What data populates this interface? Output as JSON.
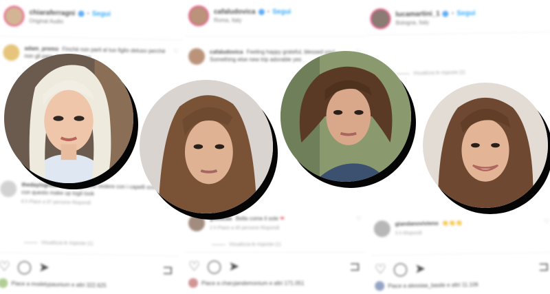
{
  "panels": [
    {
      "username": "chiaraferragni",
      "follow_label": "Segui",
      "subtitle": "Original Audio",
      "comments": [
        {
          "user": "adam_premo",
          "text": "Finchè non parli al tuo figlio deluso perché non gli pare che sia la cosa",
          "meta": "",
          "heart": "♡"
        },
        {
          "user": "thedayisgreat",
          "text": "Ma ti vogliamo vedere con i capelli sciolti e con questo make up logit look",
          "meta": "8 h   Piace a 97 persone   Rispondi",
          "heart": "♡"
        }
      ],
      "replies": "Visualizza le risposte (1)",
      "actions": {
        "like": "♡",
        "comment": "◯",
        "share": "➤",
        "save": "⊐"
      },
      "likes_text": "Piace a modelypaunium e altri 322.625"
    },
    {
      "username": "cafaludovica",
      "follow_label": "Segui",
      "subtitle": "Roma, Italy",
      "comments": [
        {
          "user": "cafaludovica",
          "text": "Feeling happy grateful, blessed you! Something else new trip adorable yes",
          "meta": "",
          "heart": "♡"
        },
        {
          "user": "giulucas",
          "text": "Bella come il sole",
          "emoji": "❤",
          "meta": "2 h   Piace a 40 persone   Rispondi",
          "heart": "♡"
        }
      ],
      "replies": "Visualizza le risposte (1)",
      "actions": {
        "like": "♡",
        "comment": "◯",
        "share": "➤",
        "save": "⊐"
      },
      "likes_text": "Piace a charyjandemonium e altri 171.051"
    },
    {
      "username": "lucamartini_1",
      "follow_label": "Segui",
      "subtitle": "Bologna, Italy",
      "comments": [
        {
          "user": "giandanovivieno",
          "text": "",
          "emoji": "👏👏👏",
          "meta": "5 h   Rispondi",
          "heart": "♡"
        }
      ],
      "replies": "Visualizza le risposte (2)",
      "actions": {
        "like": "♡",
        "comment": "◯",
        "share": "➤",
        "save": "⊐"
      },
      "likes_text": "Piace a alessiaa_basile e altri 11.106"
    }
  ]
}
